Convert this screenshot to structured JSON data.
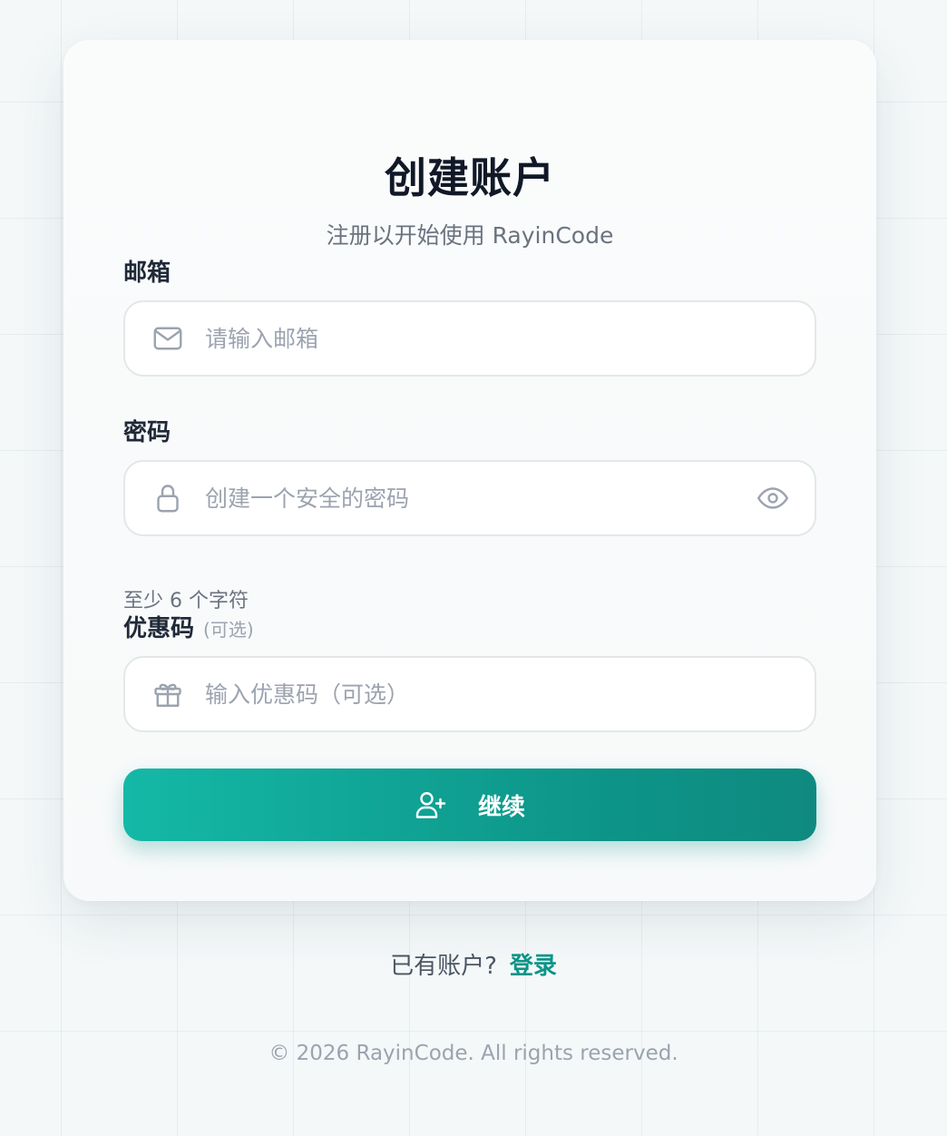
{
  "header": {
    "title": "创建账户",
    "subtitle": "注册以开始使用 RayinCode"
  },
  "form": {
    "email": {
      "label": "邮箱",
      "placeholder": "请输入邮箱",
      "value": "",
      "icon": "mail-icon"
    },
    "password": {
      "label": "密码",
      "placeholder": "创建一个安全的密码",
      "value": "",
      "icon": "lock-icon",
      "toggle_icon": "eye-icon",
      "hint": "至少 6 个字符"
    },
    "coupon": {
      "label": "优惠码",
      "optional_tag": "(可选)",
      "placeholder": "输入优惠码（可选）",
      "value": "",
      "icon": "gift-icon"
    },
    "submit": {
      "label": "继续",
      "icon": "user-plus-icon"
    }
  },
  "signin": {
    "prompt": "已有账户?",
    "link_label": "登录"
  },
  "footer": {
    "copyright": "© 2026 RayinCode. All rights reserved."
  },
  "colors": {
    "accent": "#0d9488",
    "accent_light": "#14b8a6",
    "page_background": "#f4f8f9",
    "card_background": "#fafcfc"
  }
}
